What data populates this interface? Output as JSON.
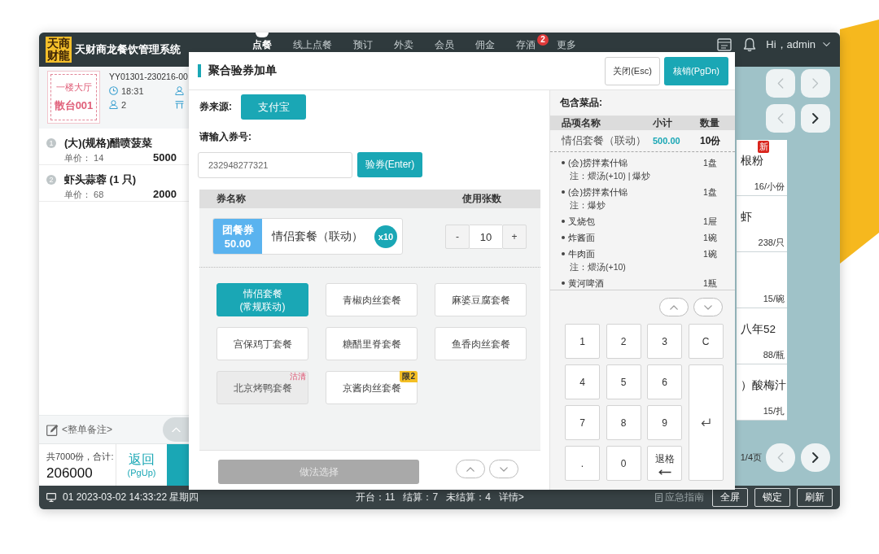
{
  "window": {
    "logo": "天商财龍",
    "title": "天财商龙餐饮管理系统"
  },
  "nav_tabs": [
    {
      "label": "点餐",
      "selected": true
    },
    {
      "label": "线上点餐",
      "selected": false
    },
    {
      "label": "预订",
      "selected": false
    },
    {
      "label": "外卖",
      "selected": false
    },
    {
      "label": "会员",
      "selected": false
    },
    {
      "label": "佣金",
      "selected": false
    },
    {
      "label": "存酒",
      "selected": false,
      "badge": "2"
    },
    {
      "label": "更多",
      "selected": false
    }
  ],
  "user": {
    "greeting": "Hi，admin"
  },
  "order": {
    "area": "一楼大厅",
    "table": "散台001",
    "number": "YY01301-230216-00",
    "time": "18:31",
    "guests": "2"
  },
  "order_items": [
    {
      "index": "1",
      "name": "(大)(规格)醋喷菠菜",
      "unit_price": "单价： 14",
      "amount": "5000"
    },
    {
      "index": "2",
      "name": "虾头蒜蓉 (1 只)",
      "unit_price": "单价： 68",
      "amount": "2000"
    }
  ],
  "remark": "<整单备注>",
  "summary": {
    "count": "共7000份，合计:",
    "total": "206000",
    "back": "返回",
    "back_key": "(PgUp)"
  },
  "category_nav": [
    {
      "previous_disabled": true,
      "next_disabled": true
    },
    {
      "previous_disabled": true,
      "next_disabled": false
    }
  ],
  "menu_cards": [
    {
      "name": "根粉",
      "price": "16/小份",
      "badge": "新"
    },
    {
      "name": "虾",
      "price": "238/只"
    },
    {
      "price": "15/碗"
    },
    {
      "name": "八年52",
      "price": "88/瓶"
    },
    {
      "name": "）酸梅汁",
      "price": "15/扎"
    }
  ],
  "pager": {
    "label": "1/4页",
    "previous_disabled": true,
    "next_disabled": false
  },
  "dialog": {
    "title": "聚合验券加单",
    "actions": [
      {
        "label": "关闭(Esc)",
        "kind": "secondary"
      },
      {
        "label": "核销(PgDn)",
        "kind": "primary"
      }
    ],
    "source": {
      "label": "券来源:",
      "value": "支付宝"
    },
    "code": {
      "label": "请输入券号:",
      "value": "232948277321",
      "button": "验券(Enter)"
    },
    "voucher_columns": [
      "券名称",
      "使用张数"
    ],
    "vouchers": [
      {
        "type": "团餐券",
        "price": "50.00",
        "name": "情侣套餐（联动）",
        "count": "x10",
        "decrease": "-",
        "quantity": "10",
        "increase": "+"
      }
    ],
    "packages": [
      {
        "label": "情侣套餐\n(常规联动)",
        "selected": true,
        "disabled": false
      },
      {
        "label": "青椒肉丝套餐",
        "selected": false,
        "disabled": false
      },
      {
        "label": "麻婆豆腐套餐",
        "selected": false,
        "disabled": false
      },
      {
        "label": "宫保鸡丁套餐",
        "selected": false,
        "disabled": false
      },
      {
        "label": "糖醋里脊套餐",
        "selected": false,
        "disabled": false
      },
      {
        "label": "鱼香肉丝套餐",
        "selected": false,
        "disabled": false
      },
      {
        "label": "北京烤鸭套餐",
        "selected": false,
        "disabled": true,
        "tag": "沽清"
      },
      {
        "label": "京酱肉丝套餐",
        "selected": false,
        "disabled": false,
        "limit": "限2"
      }
    ],
    "method_button": {
      "label": "做法选择",
      "disabled": true
    },
    "included": {
      "title": "包含菜品:",
      "columns": [
        "品项名称",
        "小计",
        "数量"
      ],
      "item": {
        "name": "情侣套餐（联动）",
        "subtotal": "500.00",
        "quantity": "10份"
      },
      "dishes": [
        {
          "name": "(会)捞拌素什锦",
          "note": "注：煨汤(+10) | 爆炒",
          "quantity": "1盘"
        },
        {
          "name": "(会)捞拌素什锦",
          "note": "注：爆炒",
          "quantity": "1盘"
        },
        {
          "name": "叉烧包",
          "quantity": "1屉"
        },
        {
          "name": "炸酱面",
          "quantity": "1碗"
        },
        {
          "name": "牛肉面",
          "note": "注：煨汤(+10)",
          "quantity": "1碗"
        },
        {
          "name": "黄河啤酒",
          "quantity": "1瓶"
        }
      ]
    },
    "keypad": [
      {
        "kind": "key",
        "label": "1"
      },
      {
        "kind": "key",
        "label": "2"
      },
      {
        "kind": "key",
        "label": "3"
      },
      {
        "kind": "key",
        "label": "C"
      },
      {
        "kind": "key",
        "label": "4"
      },
      {
        "kind": "key",
        "label": "5"
      },
      {
        "kind": "key",
        "label": "6"
      },
      {
        "kind": "enter"
      },
      {
        "kind": "key",
        "label": "7"
      },
      {
        "kind": "key",
        "label": "8"
      },
      {
        "kind": "key",
        "label": "9"
      },
      {
        "kind": "key",
        "label": "."
      },
      {
        "kind": "key",
        "label": "0"
      },
      {
        "kind": "backspace",
        "label": "退格"
      }
    ]
  },
  "status_bar": {
    "terminal": "01 2023-03-02 14:33:22 星期四",
    "stats": [
      "开台：11",
      "结算：7",
      "未结算：4"
    ],
    "details": "详情>",
    "guide": "应急指南",
    "buttons": [
      "全屏",
      "锁定",
      "刷新"
    ]
  }
}
